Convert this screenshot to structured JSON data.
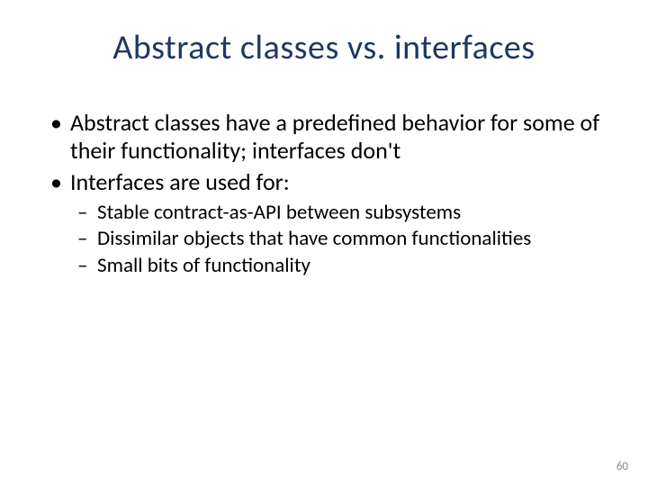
{
  "title": "Abstract classes vs. interfaces",
  "bullets_l1": [
    "Abstract classes have a predefined behavior for some of their functionality; interfaces don't",
    "Interfaces are used for:"
  ],
  "bullets_l2": [
    "Stable contract-as-API between subsystems",
    "Dissimilar objects that have common functionalities",
    "Small bits of functionality"
  ],
  "page_number": "60"
}
